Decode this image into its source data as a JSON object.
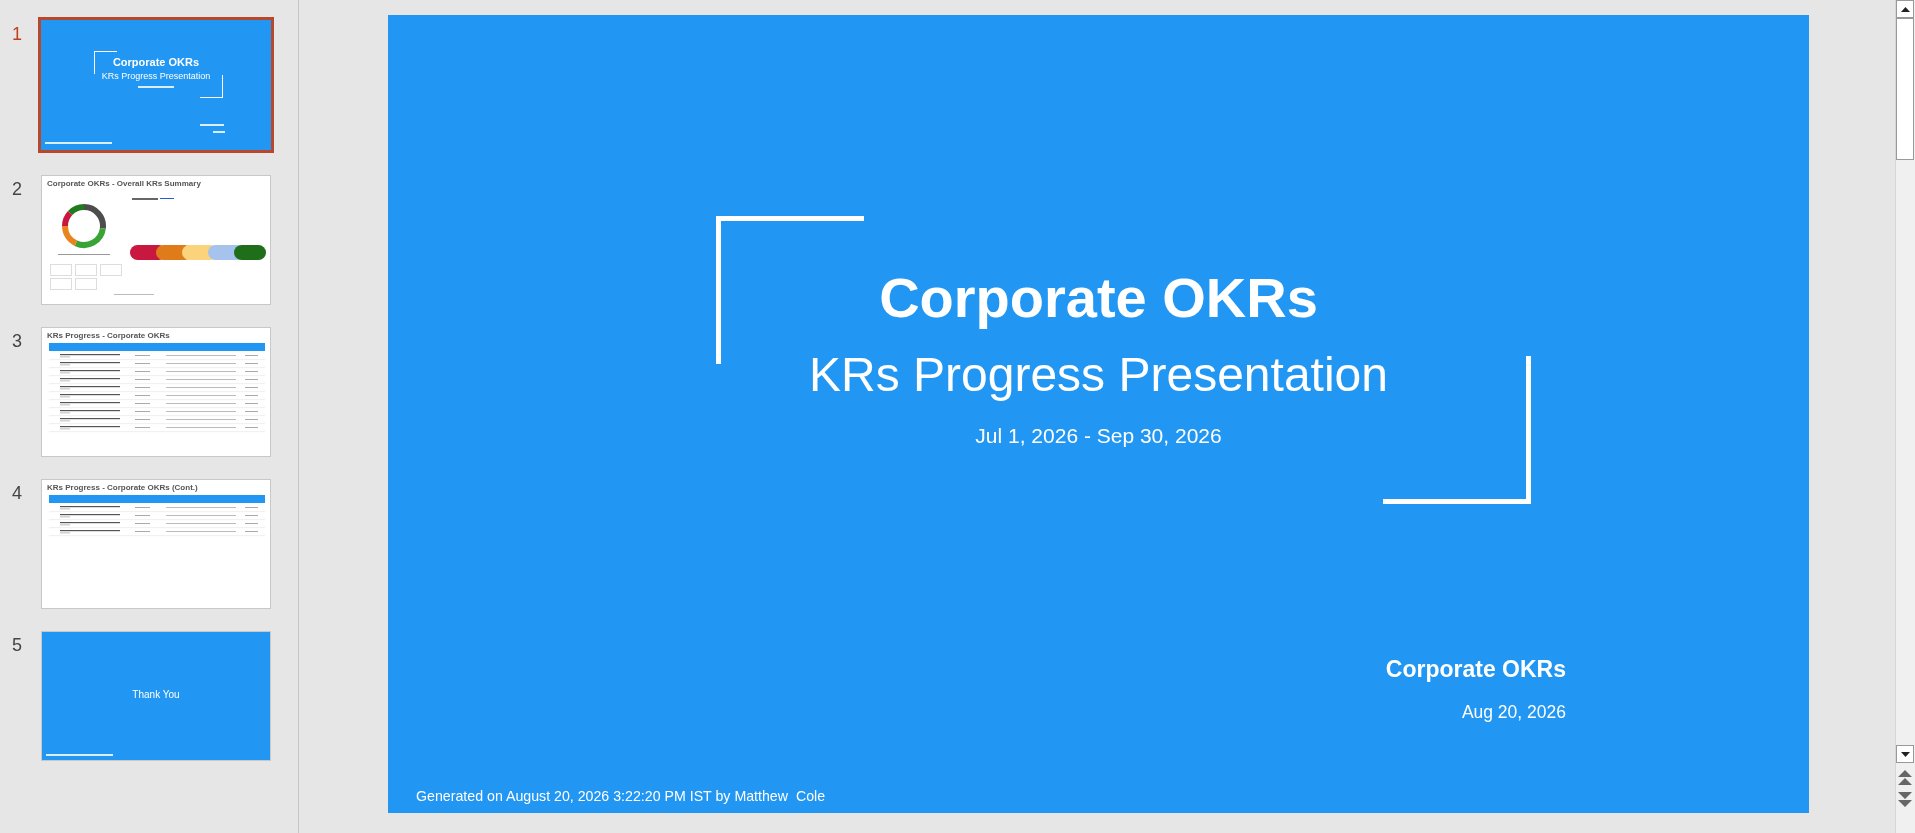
{
  "slide_panel": {
    "thumbnails": [
      {
        "number": "1",
        "selected": true,
        "kind": "title",
        "title": "Corporate OKRs",
        "subtitle": "KRs Progress Presentation"
      },
      {
        "number": "2",
        "selected": false,
        "kind": "summary",
        "title": "Corporate OKRs - Overall KRs Summary"
      },
      {
        "number": "3",
        "selected": false,
        "kind": "table",
        "title": "KRs Progress - Corporate OKRs"
      },
      {
        "number": "4",
        "selected": false,
        "kind": "table_continued",
        "title": "KRs Progress - Corporate OKRs (Cont.)"
      },
      {
        "number": "5",
        "selected": false,
        "kind": "closing",
        "title": "Thank You"
      }
    ]
  },
  "slide": {
    "title": "Corporate OKRs",
    "subtitle": "KRs Progress Presentation",
    "date_range": "Jul 1, 2026 - Sep 30, 2026",
    "organization": "Corporate OKRs",
    "date": "Aug 20, 2026",
    "footer": "Generated on August 20, 2026 3:22:20 PM IST by Matthew  Cole"
  }
}
